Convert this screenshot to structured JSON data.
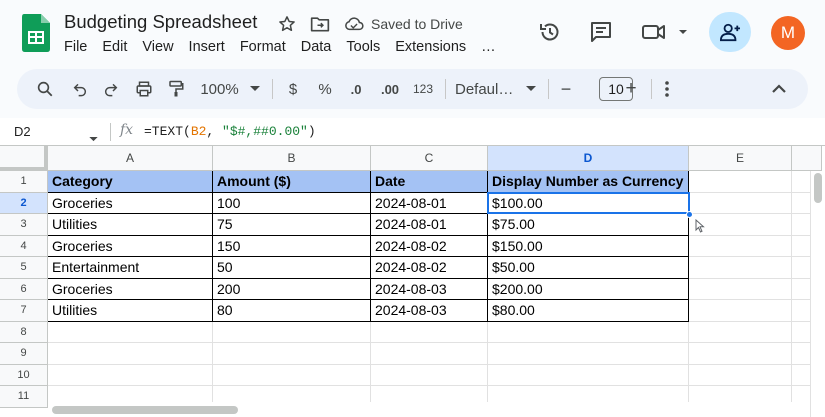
{
  "app": {
    "title": "Budgeting Spreadsheet",
    "save_status": "Saved to Drive",
    "avatar_initial": "M",
    "brand_color": "#0f9d58",
    "accent_color": "#1a73e8"
  },
  "menu": [
    "File",
    "Edit",
    "View",
    "Insert",
    "Format",
    "Data",
    "Tools",
    "Extensions",
    "…"
  ],
  "toolbar": {
    "zoom": "100%",
    "currency": "$",
    "percent": "%",
    "decrease_decimal": ".0",
    "increase_decimal": ".00",
    "more_formats": "123",
    "font": "Defaul…",
    "font_size": "10",
    "minus": "−",
    "plus": "+"
  },
  "formula_bar": {
    "cell_ref": "D2",
    "fx": "fx",
    "formula_fn": "=TEXT(",
    "formula_ref": "B2",
    "formula_sep": ", ",
    "formula_str": "\"$#,##0.00\"",
    "formula_end": ")"
  },
  "columns": [
    "A",
    "B",
    "C",
    "D",
    "E"
  ],
  "rows": [
    "1",
    "2",
    "3",
    "4",
    "5",
    "6",
    "7",
    "8",
    "9",
    "10",
    "11"
  ],
  "selection": {
    "column": "D",
    "row": "2"
  },
  "table": {
    "headers": [
      "Category",
      "Amount ($)",
      "Date",
      "Display Number as Currency"
    ],
    "rows": [
      [
        "Groceries",
        "100",
        "2024-08-01",
        "$100.00"
      ],
      [
        "Utilities",
        "75",
        "2024-08-01",
        "$75.00"
      ],
      [
        "Groceries",
        "150",
        "2024-08-02",
        "$150.00"
      ],
      [
        "Entertainment",
        "50",
        "2024-08-02",
        "$50.00"
      ],
      [
        "Groceries",
        "200",
        "2024-08-03",
        "$200.00"
      ],
      [
        "Utilities",
        "80",
        "2024-08-03",
        "$80.00"
      ]
    ]
  }
}
